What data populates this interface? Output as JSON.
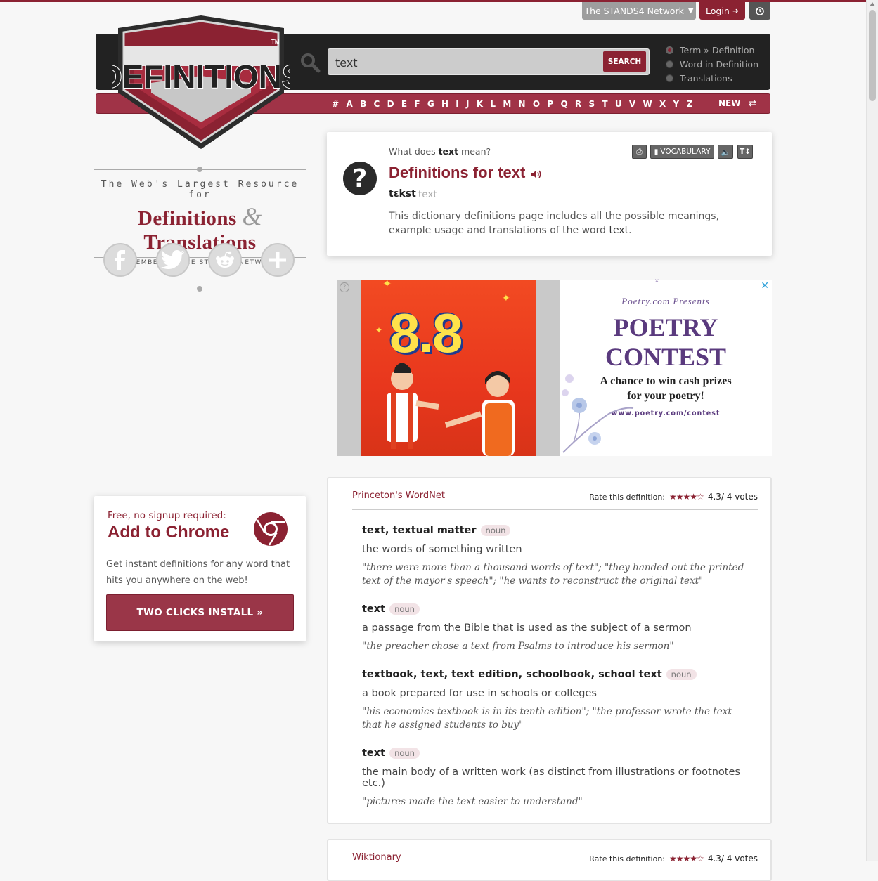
{
  "topbar": {
    "network_label": "The STANDS4 Network",
    "login_label": "Login"
  },
  "header": {
    "logo_text": "DEFINITIONS",
    "search_value": "text",
    "search_button": "SEARCH",
    "radio_options": [
      "Term » Definition",
      "Word in Definition",
      "Translations"
    ],
    "alphabet": [
      "#",
      "A",
      "B",
      "C",
      "D",
      "E",
      "F",
      "G",
      "H",
      "I",
      "J",
      "K",
      "L",
      "M",
      "N",
      "O",
      "P",
      "Q",
      "R",
      "S",
      "T",
      "U",
      "V",
      "W",
      "X",
      "Y",
      "Z"
    ],
    "new_label": "NEW"
  },
  "sidebar": {
    "tagline_top": "The Web's Largest Resource for",
    "tagline_left": "Definitions",
    "tagline_amp": "&",
    "tagline_right": "Translations",
    "member_line": "A MEMBER OF THE STANDS4 NETWORK",
    "social": [
      "facebook-icon",
      "twitter-icon",
      "reddit-icon",
      "plus-icon"
    ]
  },
  "chrome_card": {
    "free_text": "Free, no signup required:",
    "title": "Add to Chrome",
    "desc": "Get instant definitions for any word that hits you anywhere on the web!",
    "button": "TWO CLICKS INSTALL »"
  },
  "definition_card": {
    "what_prefix": "What does ",
    "what_word": "text",
    "what_suffix": " mean?",
    "title": "Definitions for text",
    "pronunciation": "tɛkst",
    "pron_alt": "text",
    "desc_prefix": "This dictionary definitions page includes all the possible meanings, example usage and translations of the word ",
    "desc_word": "text",
    "desc_suffix": ".",
    "vocab_label": "VOCABULARY"
  },
  "ad": {
    "left_headline": "8.8",
    "poetry_presents": "Poetry.com Presents",
    "poetry_title_1": "POETRY",
    "poetry_title_2": "CONTEST",
    "poetry_sub_1": "A chance to win cash prizes",
    "poetry_sub_2": "for your poetry!",
    "poetry_url": "www.poetry.com/contest"
  },
  "wordnet": {
    "source": "Princeton's WordNet",
    "rate_label": "Rate this definition:",
    "stars": "★★★★☆",
    "score": "4.3",
    "votes": " / 4 votes",
    "entries": [
      {
        "term": "text, textual matter",
        "pos": "noun",
        "def": "the words of something written",
        "ex": "\"there were more than a thousand words of text\"; \"they handed out the printed text of the mayor's speech\"; \"he wants to reconstruct the original text\""
      },
      {
        "term": "text",
        "pos": "noun",
        "def": "a passage from the Bible that is used as the subject of a sermon",
        "ex": "\"the preacher chose a text from Psalms to introduce his sermon\""
      },
      {
        "term": "textbook, text, text edition, schoolbook, school text",
        "pos": "noun",
        "def": "a book prepared for use in schools or colleges",
        "ex": "\"his economics textbook is in its tenth edition\"; \"the professor wrote the text that he assigned students to buy\""
      },
      {
        "term": "text",
        "pos": "noun",
        "def": "the main body of a written work (as distinct from illustrations or footnotes etc.)",
        "ex": "\"pictures made the text easier to understand\""
      }
    ]
  },
  "wiktionary": {
    "source": "Wiktionary",
    "rate_label": "Rate this definition:",
    "stars": "★★★★☆",
    "score": "4.3",
    "votes": " / 4 votes"
  }
}
